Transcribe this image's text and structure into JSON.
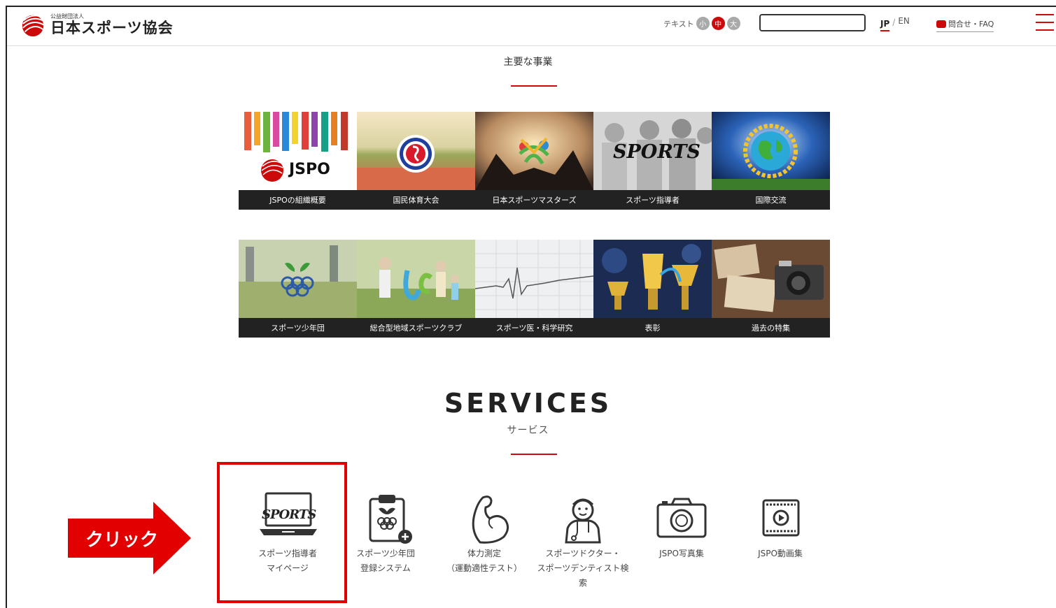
{
  "header": {
    "logo_sub": "公益財団法人",
    "logo_main": "日本スポーツ協会",
    "textsize_label": "テキスト",
    "textsize_small": "小",
    "textsize_mid": "中",
    "textsize_large": "大",
    "search_placeholder": "",
    "lang_jp": "JP",
    "lang_sep": "/",
    "lang_en": "EN",
    "faq": "問合せ・FAQ"
  },
  "main_business": {
    "title": "主要な事業",
    "row1": [
      {
        "label": "JSPOの組織概要",
        "img_text": "JSPO"
      },
      {
        "label": "国民体育大会"
      },
      {
        "label": "日本スポーツマスターズ"
      },
      {
        "label": "スポーツ指導者",
        "img_text": "SPORTS"
      },
      {
        "label": "国際交流"
      }
    ],
    "row2": [
      {
        "label": "スポーツ少年団"
      },
      {
        "label": "総合型地域スポーツクラブ"
      },
      {
        "label": "スポーツ医・科学研究"
      },
      {
        "label": "表彰"
      },
      {
        "label": "過去の特集"
      }
    ]
  },
  "services": {
    "title": "SERVICES",
    "subtitle": "サービス",
    "items": [
      {
        "line1": "スポーツ指導者",
        "line2": "マイページ",
        "icon": "laptop-sports-icon",
        "icon_text": "SPORTS"
      },
      {
        "line1": "スポーツ少年団",
        "line2": "登録システム",
        "icon": "clipboard-add-icon"
      },
      {
        "line1": "体力測定",
        "line2": "（運動適性テスト）",
        "icon": "muscle-arm-icon"
      },
      {
        "line1": "スポーツドクター・",
        "line2": "スポーツデンティスト検",
        "line3": "索",
        "icon": "doctor-icon"
      },
      {
        "line1": "JSPO写真集",
        "icon": "camera-icon"
      },
      {
        "line1": "JSPO動画集",
        "icon": "video-play-icon"
      }
    ]
  },
  "annotation": {
    "arrow_text": "クリック"
  },
  "colors": {
    "accent": "#cc0a0a",
    "highlight": "#e30000",
    "tile_label_bg": "#222222"
  }
}
